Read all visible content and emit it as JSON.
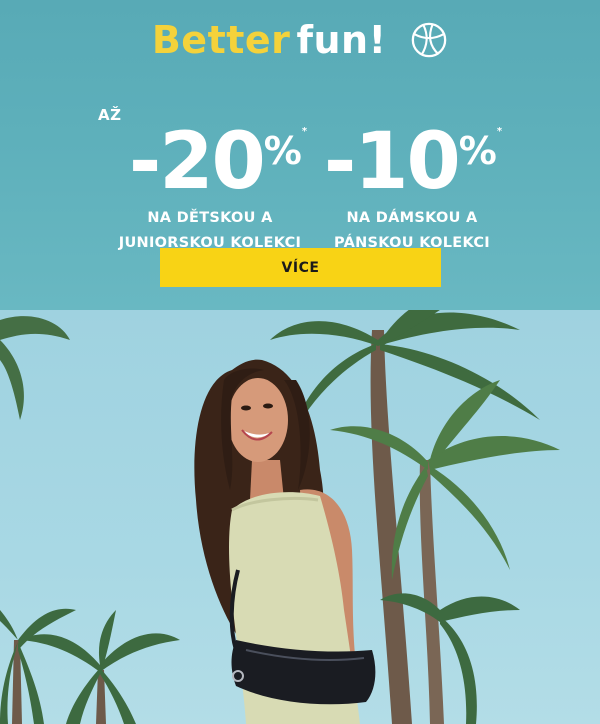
{
  "promo": {
    "headline": {
      "word1": "Better",
      "word2": "fun!"
    },
    "offer_kids": {
      "prefix": "AŽ",
      "value": "-20",
      "percent": "%",
      "star": "*",
      "line1": "NA DĚTSKOU A",
      "line2": "JUNIORSKOU KOLEKCI"
    },
    "offer_adults": {
      "value": "-10",
      "percent": "%",
      "star": "*",
      "line1": "NA DÁMSKOU A",
      "line2": "PÁNSKOU KOLEKCI"
    },
    "cta_label": "VÍCE"
  },
  "icons": {
    "headline_icon": "beach-ball-icon"
  },
  "colors": {
    "banner_teal": "#5eb0bb",
    "headline_yellow": "#f4d23b",
    "cta_yellow": "#f8d315",
    "sky": "#a8d8e4"
  }
}
